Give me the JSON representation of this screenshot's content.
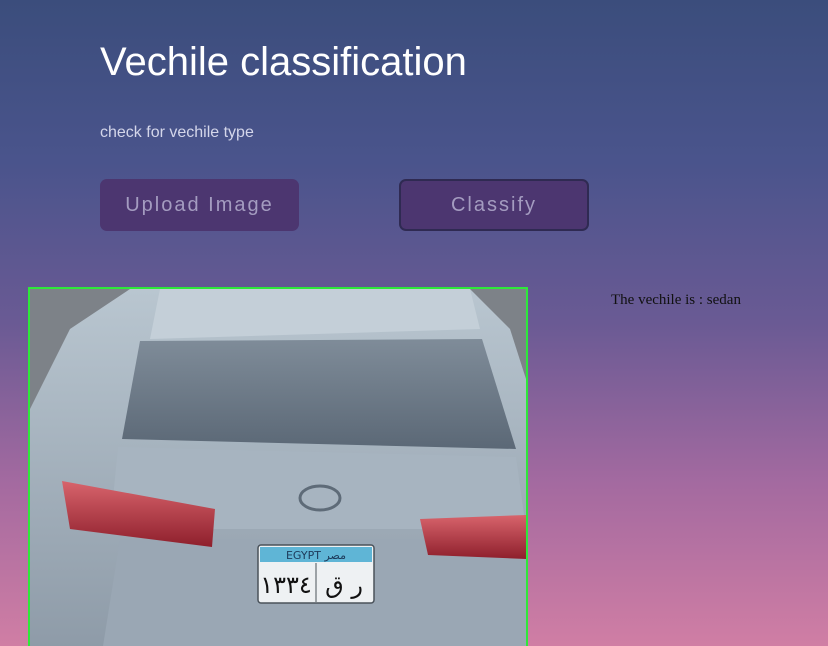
{
  "header": {
    "title": "Vechile classification",
    "subtitle": "check for vechile type"
  },
  "actions": {
    "upload_label": "Upload Image",
    "classify_label": "Classify"
  },
  "result": {
    "text": "The vechile is : sedan"
  },
  "preview": {
    "plate_top": "EGYPT  مصر",
    "plate_digits": "١٣٣٤",
    "plate_letters": "ر ق"
  },
  "colors": {
    "accent_border": "#2ee83a",
    "button_bg": "#4c3670",
    "button_text": "#a49cc0"
  }
}
